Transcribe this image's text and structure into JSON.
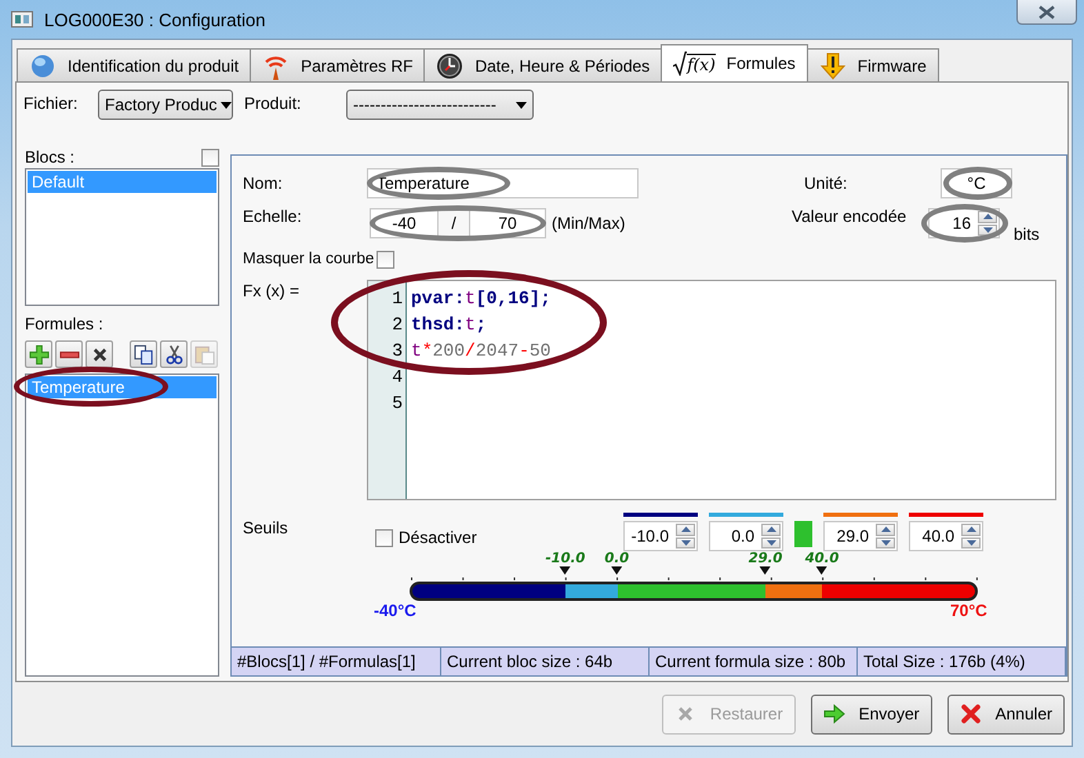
{
  "window": {
    "title": "LOG000E30 : Configuration"
  },
  "tabs": [
    {
      "label": "Identification du produit",
      "selected": false
    },
    {
      "label": "Paramètres RF",
      "selected": false
    },
    {
      "label": "Date, Heure & Périodes",
      "selected": false
    },
    {
      "label": "Formules",
      "icon_text": "f(x)",
      "selected": true
    },
    {
      "label": "Firmware",
      "selected": false
    }
  ],
  "file_selector": {
    "label": "Fichier:",
    "value": "Factory Produc"
  },
  "product_selector": {
    "label": "Produit:",
    "value": "--------------------------"
  },
  "blocks": {
    "label": "Blocs :",
    "checked": false,
    "items": [
      {
        "label": "Default",
        "selected": true
      }
    ]
  },
  "formulas": {
    "label": "Formules :",
    "toolbar": [
      {
        "disabled": false
      },
      {
        "disabled": false
      },
      {
        "disabled": false
      },
      {
        "disabled": false
      },
      {
        "disabled": false
      },
      {
        "disabled": true
      }
    ],
    "items": [
      {
        "label": "Temperature",
        "selected": true,
        "circle": {
          "color": "#7b0f1f"
        }
      }
    ]
  },
  "editor_panel": {
    "name": {
      "label": "Nom:",
      "value": "Temperature",
      "circle": {
        "color": "#808080"
      }
    },
    "unit": {
      "label": "Unité:",
      "value": "°C",
      "circle": {
        "color": "#808080"
      }
    },
    "scale": {
      "label": "Echelle:",
      "min": "-40",
      "separator": "/",
      "max": "70",
      "hint": "(Min/Max)",
      "circle": {
        "color": "#808080"
      }
    },
    "encoded": {
      "label": "Valeur encodée",
      "value": "16",
      "unit": "bits",
      "circle": {
        "color": "#808080"
      }
    },
    "hide_curve": {
      "label": "Masquer la courbe",
      "checked": false
    },
    "function": {
      "label": "Fx (x) =",
      "circle": {
        "color": "#7b0f1f"
      },
      "lines": [
        {
          "number": "1",
          "tokens": [
            {
              "text": "pvar:",
              "kind": "keyword"
            },
            {
              "text": "t",
              "kind": "variable"
            },
            {
              "text": "[0,16];",
              "kind": "keyword"
            }
          ]
        },
        {
          "number": "2",
          "tokens": [
            {
              "text": "thsd:",
              "kind": "keyword"
            },
            {
              "text": "t",
              "kind": "variable"
            },
            {
              "text": ";",
              "kind": "keyword"
            }
          ]
        },
        {
          "number": "3",
          "tokens": [
            {
              "text": "t",
              "kind": "variable"
            },
            {
              "text": "*",
              "kind": "operator"
            },
            {
              "text": "200",
              "kind": "number"
            },
            {
              "text": "/",
              "kind": "operator"
            },
            {
              "text": "2047",
              "kind": "number"
            },
            {
              "text": "-",
              "kind": "operator"
            },
            {
              "text": "50",
              "kind": "number"
            }
          ]
        },
        {
          "number": "4"
        },
        {
          "number": "5"
        }
      ]
    },
    "thresholds": {
      "label": "Seuils",
      "disable": {
        "label": "Désactiver",
        "checked": false
      },
      "fields": [
        {
          "value": "-10.0",
          "color": "#000080"
        },
        {
          "value": "0.0",
          "color": "#33aadd"
        },
        {
          "value": "29.0",
          "color": "#f07010"
        },
        {
          "value": "40.0",
          "color": "#ee0000"
        }
      ],
      "middle": {
        "color": "#2ec02e"
      },
      "scale": {
        "min_label": "-40°C",
        "max_label": "70°C",
        "markers": [
          {
            "label": "-10.0",
            "level": 0.273
          },
          {
            "label": "0.0",
            "level": 0.364
          },
          {
            "label": "29.0",
            "level": 0.627
          },
          {
            "label": "40.0",
            "level": 0.727
          }
        ]
      }
    }
  },
  "status_bar": [
    "#Blocs[1] / #Formulas[1]",
    "Current bloc size : 64b",
    "Current formula size : 80b",
    "Total Size : 176b (4%)"
  ],
  "buttons": [
    {
      "label": "Restaurer",
      "disabled": true
    },
    {
      "label": "Envoyer",
      "disabled": false
    },
    {
      "label": "Annuler",
      "disabled": false
    }
  ]
}
